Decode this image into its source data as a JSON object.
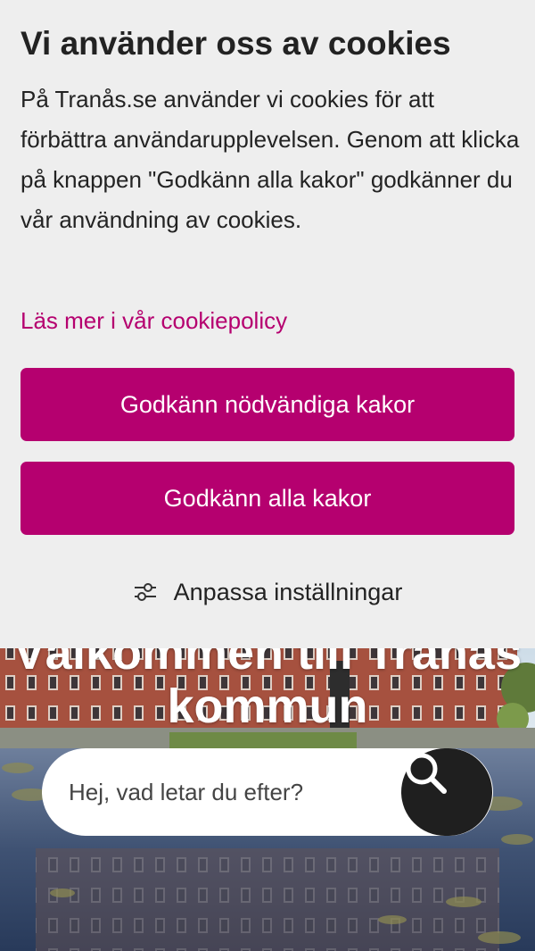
{
  "cookie_banner": {
    "title": "Vi använder oss av cookies",
    "body": "På Tranås.se använder vi cookies för att förbättra användarupplevelsen. Genom att klicka på knappen \"Godkänn alla kakor\" godkänner du vår användning av cookies.",
    "policy_link": "Läs mer i vår cookiepolicy",
    "accept_necessary_label": "Godkänn nödvändiga kakor",
    "accept_all_label": "Godkänn alla kakor",
    "customize_label": "Anpassa inställningar",
    "customize_icon": "sliders-icon"
  },
  "hero": {
    "title_line1": "Välkommen till Tranås",
    "title_line2": "kommun"
  },
  "search": {
    "placeholder": "Hej, vad letar du efter?",
    "button_icon": "search-icon"
  },
  "colors": {
    "accent": "#b5006f",
    "panel_background": "#eeeeee",
    "search_button": "#1f1f1f"
  }
}
